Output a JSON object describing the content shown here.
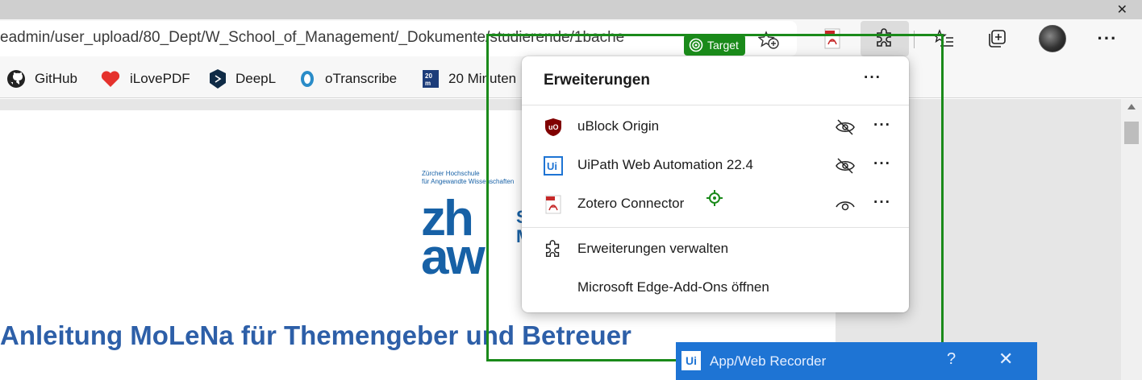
{
  "window": {
    "close_glyph": "✕"
  },
  "toolbar": {
    "url": "eadmin/user_upload/80_Dept/W_School_of_Management/_Dokumente/studierende/1bache",
    "icons": [
      "add-favorite-icon",
      "pdf-extension-icon",
      "extensions-icon",
      "favorites-icon",
      "collections-icon",
      "profile-avatar",
      "settings-more-icon"
    ],
    "more_glyph": "···"
  },
  "favorites": [
    {
      "label": "GitHub",
      "icon": "github-icon"
    },
    {
      "label": "iLovePDF",
      "icon": "ilovepdf-icon"
    },
    {
      "label": "DeepL",
      "icon": "deepl-icon"
    },
    {
      "label": "oTranscribe",
      "icon": "otranscribe-icon"
    },
    {
      "label": "20 Minuten",
      "icon": "20min-icon"
    }
  ],
  "document": {
    "institution_line1": "Zürcher Hochschule",
    "institution_line2": "für Angewandte Wissenschaften",
    "logo_line1": "zh",
    "logo_line2": "aw",
    "logo_side1": "S",
    "logo_side2": "M",
    "title": "Anleitung MoLeNa für Themengeber und Betreuer"
  },
  "extensions_popup": {
    "title": "Erweiterungen",
    "more_glyph": "···",
    "items": [
      {
        "label": "uBlock Origin",
        "icon": "ublock-icon",
        "visibility": "hidden"
      },
      {
        "label": "UiPath Web Automation 22.4",
        "icon": "uipath-icon",
        "visibility": "hidden"
      },
      {
        "label": "Zotero Connector",
        "icon": "zotero-icon",
        "visibility": "visible"
      }
    ],
    "manage_label": "Erweiterungen verwalten",
    "addons_label": "Microsoft Edge-Add-Ons öffnen"
  },
  "target": {
    "label": "Target",
    "color": "#1a8a1a"
  },
  "recorder": {
    "logo": "Ui",
    "title": "App/Web Recorder",
    "help": "?",
    "close": "✕",
    "color": "#1e74d4"
  }
}
